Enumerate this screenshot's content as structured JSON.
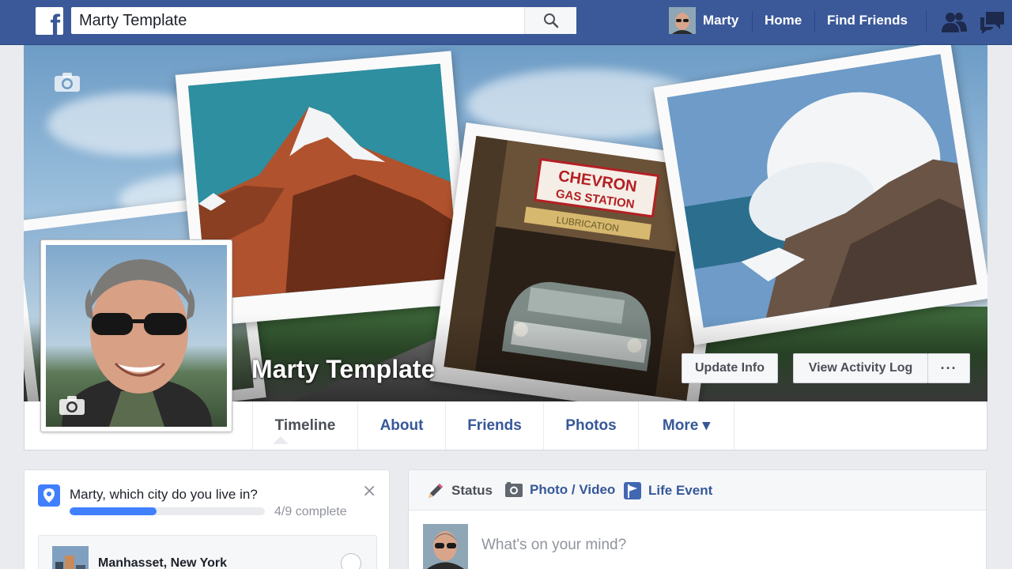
{
  "topbar": {
    "logo_letter": "f",
    "search_value": "Marty Template",
    "user_name": "Marty",
    "home_label": "Home",
    "find_friends_label": "Find Friends",
    "icons": [
      "facebook-logo-icon",
      "search-icon",
      "friend-requests-icon",
      "messages-icon"
    ]
  },
  "cover": {
    "profile_name": "Marty Template",
    "polaroid_labels": {
      "gas_station_sign_line1": "CHEVRON",
      "gas_station_sign_line2": "GAS STATION",
      "gas_station_sign_board": "LUBRICATION"
    },
    "buttons": {
      "update_info": "Update Info",
      "view_activity_log": "View Activity Log",
      "more_options": "···"
    }
  },
  "tabs": [
    {
      "label": "Timeline",
      "active": true
    },
    {
      "label": "About",
      "active": false
    },
    {
      "label": "Friends",
      "active": false
    },
    {
      "label": "Photos",
      "active": false
    },
    {
      "label": "More ▾",
      "active": false
    }
  ],
  "profile_prompt": {
    "question": "Marty, which city do you live in?",
    "progress_text": "4/9 complete",
    "progress_fraction": 0.444,
    "close_label": "×",
    "suggestion": "Manhasset, New York"
  },
  "composer": {
    "tabs": [
      {
        "label": "Status",
        "icon": "pencil-icon"
      },
      {
        "label": "Photo / Video",
        "icon": "camera-icon"
      },
      {
        "label": "Life Event",
        "icon": "flag-icon"
      }
    ],
    "placeholder": "What's on your mind?"
  },
  "colors": {
    "brand_blue": "#3b5998",
    "link_blue": "#365899",
    "progress_blue": "#4080ff",
    "page_bg": "#e9ebee"
  }
}
